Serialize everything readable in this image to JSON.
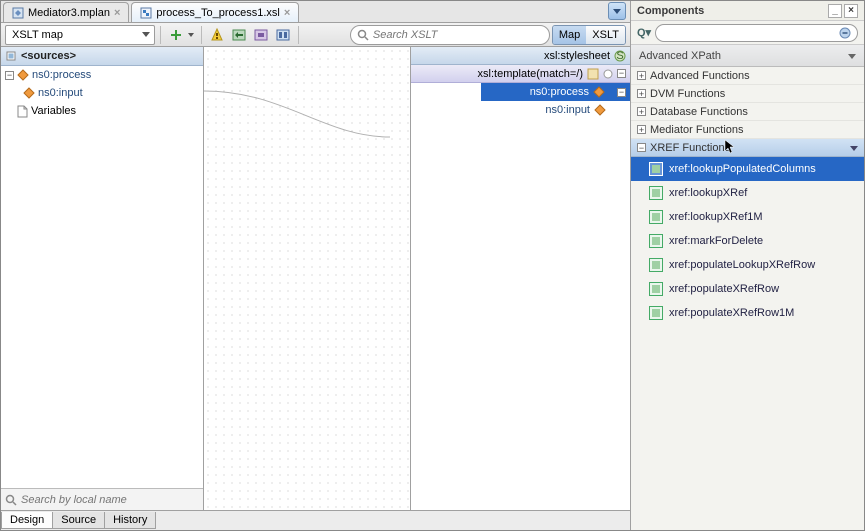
{
  "tabs": [
    {
      "label": "Mediator3.mplan",
      "active": false
    },
    {
      "label": "process_To_process1.xsl",
      "active": true
    }
  ],
  "toolbar": {
    "combo_label": "XSLT map",
    "search_placeholder": "Search XSLT",
    "toggles": [
      "Map",
      "XSLT"
    ]
  },
  "sources": {
    "header": "<sources>",
    "root": "ns0:process",
    "child": "ns0:input",
    "vars": "Variables",
    "search_placeholder": "Search by local name"
  },
  "targets": {
    "stylesheet": "xsl:stylesheet",
    "template": "xsl:template(match=/)",
    "process": "ns0:process",
    "input": "ns0:input"
  },
  "bottom_tabs": [
    "Design",
    "Source",
    "History"
  ],
  "components": {
    "title": "Components",
    "search_icon": "Q",
    "section": "Advanced XPath",
    "categories": [
      {
        "label": "Advanced Functions",
        "expanded": false
      },
      {
        "label": "DVM Functions",
        "expanded": false
      },
      {
        "label": "Database Functions",
        "expanded": false
      },
      {
        "label": "Mediator Functions",
        "expanded": false
      },
      {
        "label": "XREF Functions",
        "expanded": true
      }
    ],
    "functions": [
      "xref:lookupPopulatedColumns",
      "xref:lookupXRef",
      "xref:lookupXRef1M",
      "xref:markForDelete",
      "xref:populateLookupXRefRow",
      "xref:populateXRefRow",
      "xref:populateXRefRow1M"
    ]
  }
}
